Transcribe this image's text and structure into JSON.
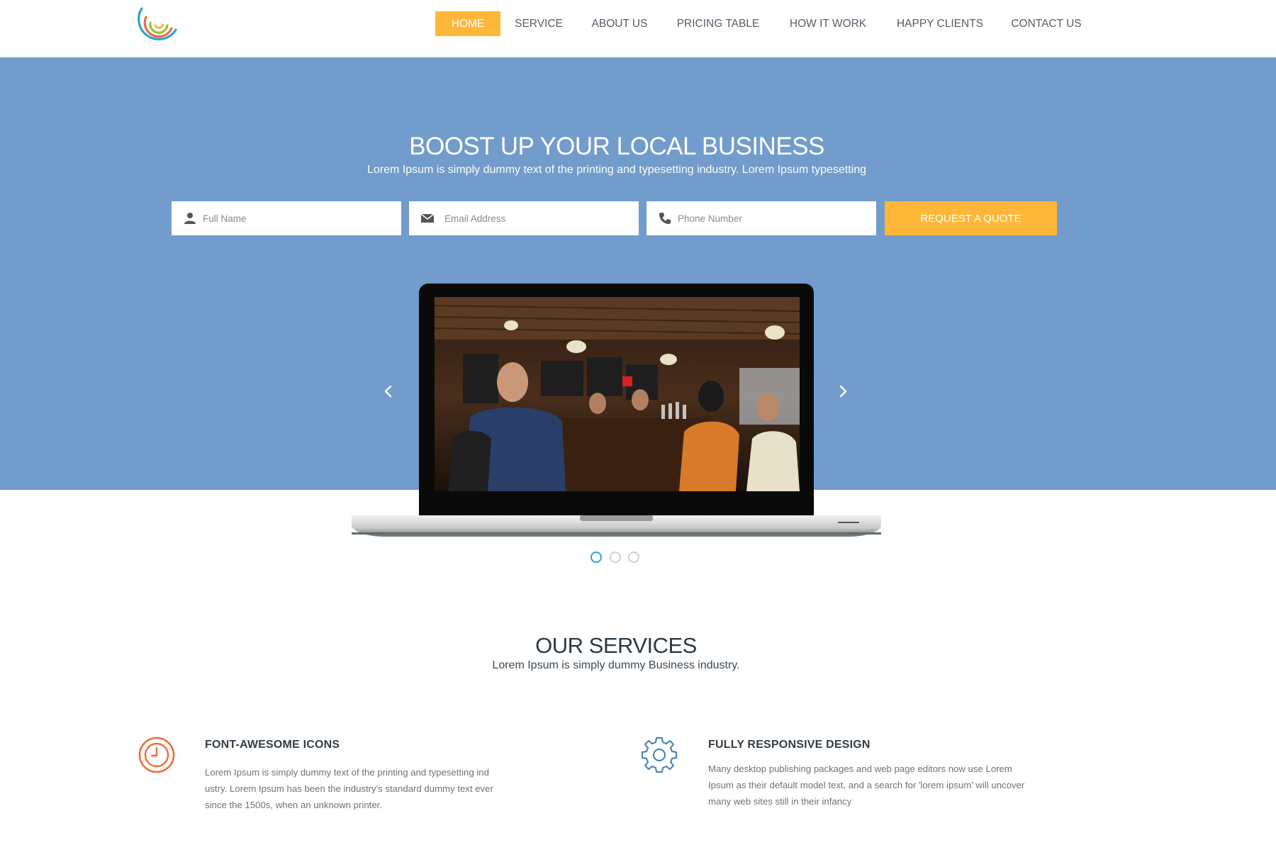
{
  "nav": {
    "items": [
      {
        "label": "HOME",
        "active": true
      },
      {
        "label": "SERVICE"
      },
      {
        "label": "ABOUT US"
      },
      {
        "label": "PRICING TABLE"
      },
      {
        "label": "HOW IT WORK"
      },
      {
        "label": "HAPPY CLIENTS"
      },
      {
        "label": "CONTACT US"
      }
    ]
  },
  "hero": {
    "title": "BOOST UP YOUR LOCAL BUSINESS",
    "subtitle": "Lorem Ipsum is simply dummy text of the printing and typesetting industry. Lorem Ipsum typesetting",
    "form": {
      "full_name_placeholder": "Full Name",
      "email_placeholder": "Email Address",
      "phone_placeholder": "Phone Number",
      "submit_label": "REQUEST A QUOTE"
    },
    "slider": {
      "slide_count": 3,
      "active_index": 0
    }
  },
  "services": {
    "title": "OUR SERVICES",
    "subtitle": "Lorem Ipsum is simply dummy Business industry.",
    "items": [
      {
        "icon": "clock-icon",
        "title": "FONT-AWESOME ICONS",
        "lines": [
          "Lorem Ipsum is simply dummy text of the printing and typesetting ind",
          "ustry. Lorem Ipsum has been the industry's standard dummy text ever",
          "since the 1500s, when an unknown printer."
        ]
      },
      {
        "icon": "gear-icon",
        "title": "FULLY RESPONSIVE DESIGN",
        "lines": [
          "Many desktop publishing packages and web page editors now use Lorem",
          "Ipsum as their default model text, and a search for 'lorem ipsum' will uncover",
          "many web sites still in their infancy"
        ]
      }
    ]
  },
  "colors": {
    "accent": "#ffb73a",
    "hero_bg": "#719ccb",
    "active_dot": "#2aa4d5"
  }
}
